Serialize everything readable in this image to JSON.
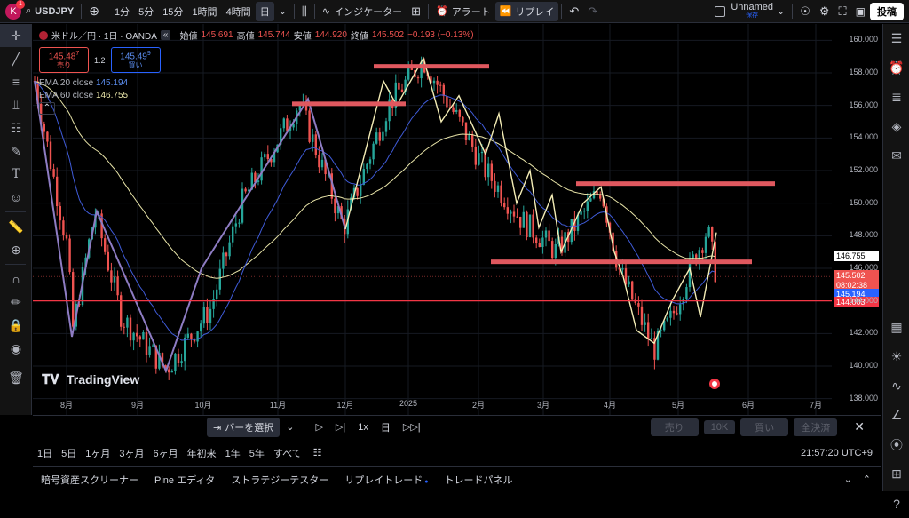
{
  "topbar": {
    "avatar_letter": "K",
    "badge": "1",
    "symbol": "USDJPY",
    "timeframes": [
      "1分",
      "5分",
      "15分",
      "1時間",
      "4時間",
      "日"
    ],
    "indicators": "インジケーター",
    "alert": "アラート",
    "replay": "リプレイ",
    "layout_name": "Unnamed",
    "layout_status": "保存",
    "post": "投稿"
  },
  "legend": {
    "title": "米ドル／円 · 1日 · OANDA",
    "open_label": "始値",
    "open": "145.691",
    "high_label": "高値",
    "high": "145.744",
    "low_label": "安値",
    "low": "144.920",
    "close_label": "終値",
    "close": "145.502",
    "change": "−0.193 (−0.13%)",
    "sell_price": "145.48",
    "sell_sup": "7",
    "sell_label": "売り",
    "spread": "1.2",
    "buy_price": "145.49",
    "buy_sup": "9",
    "buy_label": "買い",
    "ema20_label": "EMA 20 close",
    "ema20_value": "145.194",
    "ema60_label": "EMA 60 close",
    "ema60_value": "146.755"
  },
  "price_axis": {
    "ticks": [
      "160.000",
      "158.000",
      "156.000",
      "154.000",
      "152.000",
      "150.000",
      "148.000",
      "146.000",
      "144.000",
      "142.000",
      "140.000",
      "138.000"
    ],
    "ema60_tag": "146.755",
    "price_tag": "145.502",
    "countdown": "08:02:38",
    "ema20_tag": "145.194",
    "line_tag": "144.003"
  },
  "time_axis": {
    "ticks": [
      "8月",
      "9月",
      "10月",
      "11月",
      "12月",
      "2025",
      "2月",
      "3月",
      "4月",
      "5月",
      "6月",
      "7月"
    ]
  },
  "watermark": "TradingView",
  "replaybar": {
    "select_bar": "バーを選択",
    "speed": "1x",
    "interval": "日",
    "sell": "売り",
    "qty": "10K",
    "buy": "買い",
    "close_all": "全決済"
  },
  "rangebar": {
    "ranges": [
      "1日",
      "5日",
      "1ヶ月",
      "3ヶ月",
      "6ヶ月",
      "年初来",
      "1年",
      "5年",
      "すべて"
    ],
    "clock": "21:57:20 UTC+9"
  },
  "bottomtabs": {
    "tabs": [
      "暗号資産スクリーナー",
      "Pine エディタ",
      "ストラテジーテスター",
      "リプレイトレード",
      "トレードパネル"
    ]
  },
  "colors": {
    "up": "#26a69a",
    "down": "#ef5350",
    "ema20": "#3f5bd8",
    "ema60": "#e8e4a8",
    "zone": "#e0585f",
    "line144": "#f23645",
    "zigzag_purple": "#8e7cc3",
    "zigzag_yellow": "#f3ecb5"
  }
}
